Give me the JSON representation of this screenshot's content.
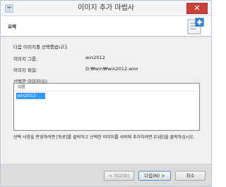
{
  "window": {
    "title": "이미지 추가 마법사",
    "close_glyph": "✕"
  },
  "header": {
    "title": "요약",
    "icon": "add-image-wizard-icon"
  },
  "content": {
    "intro": "다음 이미지를 선택했습니다.",
    "image_group_label": "이미지 그룹:",
    "image_group_value": "win2012",
    "image_file_label": "이미지 파일:",
    "image_file_value": "D:₩win₩win2012.wim",
    "selected_images_label": "선택한 이미지(S):",
    "list": {
      "column_header": "이름",
      "rows": [
        "win2012"
      ]
    },
    "footer_text": "선택 사항을 변경하려면 [뒤로]를 클릭하고 선택한 이미지를 서버에 추가하려면 [다음]을 클릭하십시오."
  },
  "buttons": {
    "back": "< 뒤로(B)",
    "next": "다음(N) >",
    "cancel": "취소"
  },
  "colors": {
    "selection": "#3399ff",
    "close_button": "#c9403a"
  }
}
